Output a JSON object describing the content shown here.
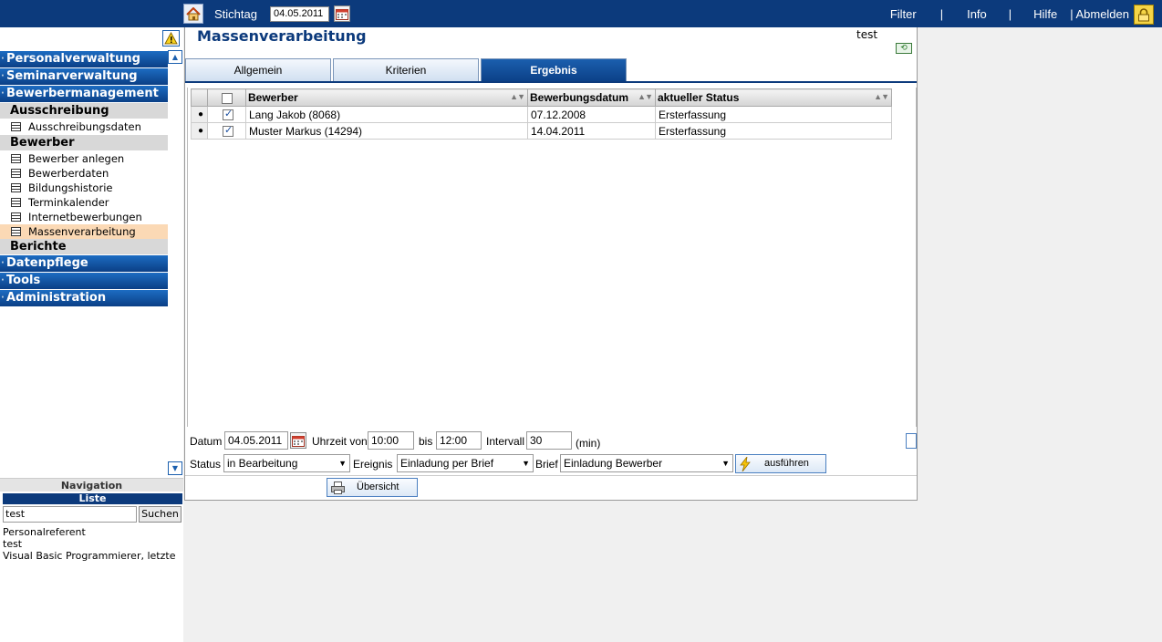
{
  "topbar": {
    "stichtag_label": "Stichtag",
    "stichtag_value": "04.05.2011",
    "nav": [
      "Filter",
      "|",
      "Info",
      "|",
      "Hilfe",
      "| Abmelden"
    ]
  },
  "sidebar": {
    "menu": [
      {
        "type": "main",
        "label": "Personalverwaltung"
      },
      {
        "type": "main",
        "label": "Seminarverwaltung"
      },
      {
        "type": "main",
        "label": "Bewerbermanagement"
      },
      {
        "type": "sub",
        "label": "Ausschreibung"
      },
      {
        "type": "item",
        "label": "Ausschreibungsdaten"
      },
      {
        "type": "sub",
        "label": "Bewerber"
      },
      {
        "type": "item",
        "label": "Bewerber anlegen"
      },
      {
        "type": "item",
        "label": "Bewerberdaten"
      },
      {
        "type": "item",
        "label": "Bildungshistorie"
      },
      {
        "type": "item",
        "label": "Terminkalender"
      },
      {
        "type": "item",
        "label": "Internetbewerbungen"
      },
      {
        "type": "item",
        "label": "Massenverarbeitung",
        "active": true
      },
      {
        "type": "sub",
        "label": "Berichte"
      },
      {
        "type": "main",
        "label": "Datenpflege"
      },
      {
        "type": "main",
        "label": "Tools"
      },
      {
        "type": "main",
        "label": "Administration"
      }
    ],
    "navigation_label": "Navigation",
    "liste_label": "Liste",
    "search_value": "test",
    "search_button": "Suchen",
    "results": [
      "Personalreferent",
      "test",
      "Visual Basic Programmierer, letzte"
    ]
  },
  "main": {
    "title": "Massenverarbeitung",
    "user": "test",
    "tabs": [
      {
        "label": "Allgemein",
        "active": false
      },
      {
        "label": "Kriterien",
        "active": false
      },
      {
        "label": "Ergebnis",
        "active": true
      }
    ],
    "grid": {
      "columns": [
        "Bewerber",
        "Bewerbungsdatum",
        "aktueller Status"
      ],
      "rows": [
        {
          "bewerber": "Lang Jakob (8068)",
          "datum": "07.12.2008",
          "status": "Ersterfassung",
          "checked": true
        },
        {
          "bewerber": "Muster Markus (14294)",
          "datum": "14.04.2011",
          "status": "Ersterfassung",
          "checked": true
        }
      ]
    },
    "form": {
      "datum_label": "Datum",
      "datum_value": "04.05.2011",
      "uhrzeit_label": "Uhrzeit von",
      "uhrzeit_von": "10:00",
      "bis_label": "bis",
      "bis_value": "12:00",
      "intervall_label": "Intervall",
      "intervall_value": "30",
      "min_label": "(min)",
      "status_label": "Status",
      "status_value": "in Bearbeitung",
      "ereignis_label": "Ereignis",
      "ereignis_value": "Einladung per Brief",
      "brief_label": "Brief",
      "brief_value": "Einladung Bewerber",
      "ausfuehren_label": "ausführen",
      "uebersicht_label": "Übersicht"
    }
  }
}
